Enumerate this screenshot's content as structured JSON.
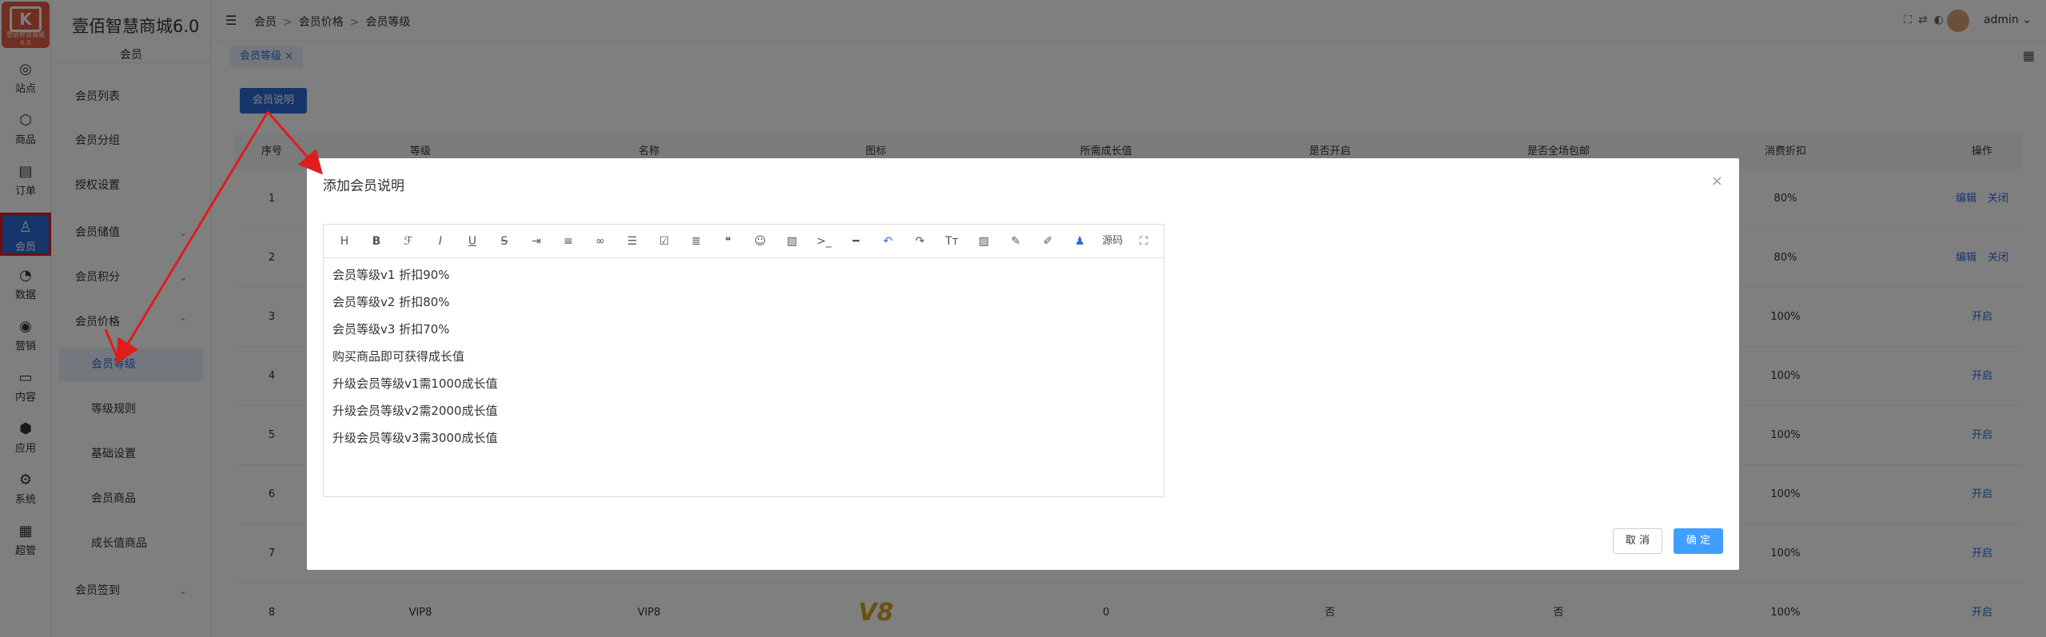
{
  "app": {
    "brand": "壹佰智慧商城6.0",
    "logo_text": "壹佰智慧商城6.0"
  },
  "iconbar": [
    {
      "label": "站点",
      "icon": "globe-icon",
      "glyph": "◎"
    },
    {
      "label": "商品",
      "icon": "box-icon",
      "glyph": "⬡"
    },
    {
      "label": "订单",
      "icon": "clipboard-icon",
      "glyph": "▤"
    },
    {
      "label": "会员",
      "icon": "user-icon",
      "glyph": "♙"
    },
    {
      "label": "数据",
      "icon": "pie-chart-icon",
      "glyph": "◔"
    },
    {
      "label": "营销",
      "icon": "target-icon",
      "glyph": "◉"
    },
    {
      "label": "内容",
      "icon": "folder-icon",
      "glyph": "▭"
    },
    {
      "label": "应用",
      "icon": "cube-icon",
      "glyph": "⬢"
    },
    {
      "label": "系统",
      "icon": "gear-icon",
      "glyph": "⚙"
    },
    {
      "label": "超管",
      "icon": "briefcase-icon",
      "glyph": "▦"
    }
  ],
  "menu": {
    "section": "会员",
    "items": [
      {
        "label": "会员列表"
      },
      {
        "label": "会员分组"
      },
      {
        "label": "授权设置"
      },
      {
        "label": "会员储值"
      },
      {
        "label": "会员积分"
      },
      {
        "label": "会员价格"
      },
      {
        "label": "会员等级"
      },
      {
        "label": "等级规则"
      },
      {
        "label": "基础设置"
      },
      {
        "label": "会员商品"
      },
      {
        "label": "成长值商品"
      },
      {
        "label": "会员签到"
      }
    ]
  },
  "header": {
    "breadcrumb": [
      "会员",
      "会员价格",
      "会员等级"
    ],
    "user": "admin"
  },
  "tabs": [
    {
      "label": "会员等级",
      "close": "×"
    }
  ],
  "page": {
    "note_button": "会员说明"
  },
  "table": {
    "columns": [
      "序号",
      "等级",
      "名称",
      "图标",
      "所需成长值",
      "是否开启",
      "是否全场包邮",
      "消费折扣",
      "操作"
    ],
    "rows": [
      {
        "no": "1",
        "discount": "80%",
        "edit": "编辑",
        "toggle": "关闭"
      },
      {
        "no": "2",
        "discount": "80%",
        "edit": "编辑",
        "toggle": "关闭"
      },
      {
        "no": "3",
        "discount": "100%",
        "toggle": "开启"
      },
      {
        "no": "4",
        "discount": "100%",
        "toggle": "开启"
      },
      {
        "no": "5",
        "discount": "100%",
        "toggle": "开启"
      },
      {
        "no": "6",
        "discount": "100%",
        "toggle": "开启"
      },
      {
        "no": "7",
        "discount": "100%",
        "toggle": "开启"
      },
      {
        "no": "8",
        "level": "VIP8",
        "name": "VIP8",
        "icon_text": "V8",
        "growth": "0",
        "enabled": "否",
        "free_ship": "否",
        "discount": "100%",
        "toggle": "开启"
      }
    ]
  },
  "dialog": {
    "title": "添加会员说明",
    "close": "×",
    "source_label": "源码",
    "lines": [
      "会员等级v1  折扣90%",
      "会员等级v2  折扣80%",
      "会员等级v3   折扣70%",
      "购买商品即可获得成长值",
      "升级会员等级v1需1000成长值",
      "升级会员等级v2需2000成长值",
      "升级会员等级v3需3000成长值"
    ],
    "cancel": "取 消",
    "confirm": "确 定"
  },
  "colors": {
    "primary": "#2d6bd4",
    "confirm": "#409eff",
    "logo": "#e25c45",
    "annotation": "#e01c1c"
  }
}
